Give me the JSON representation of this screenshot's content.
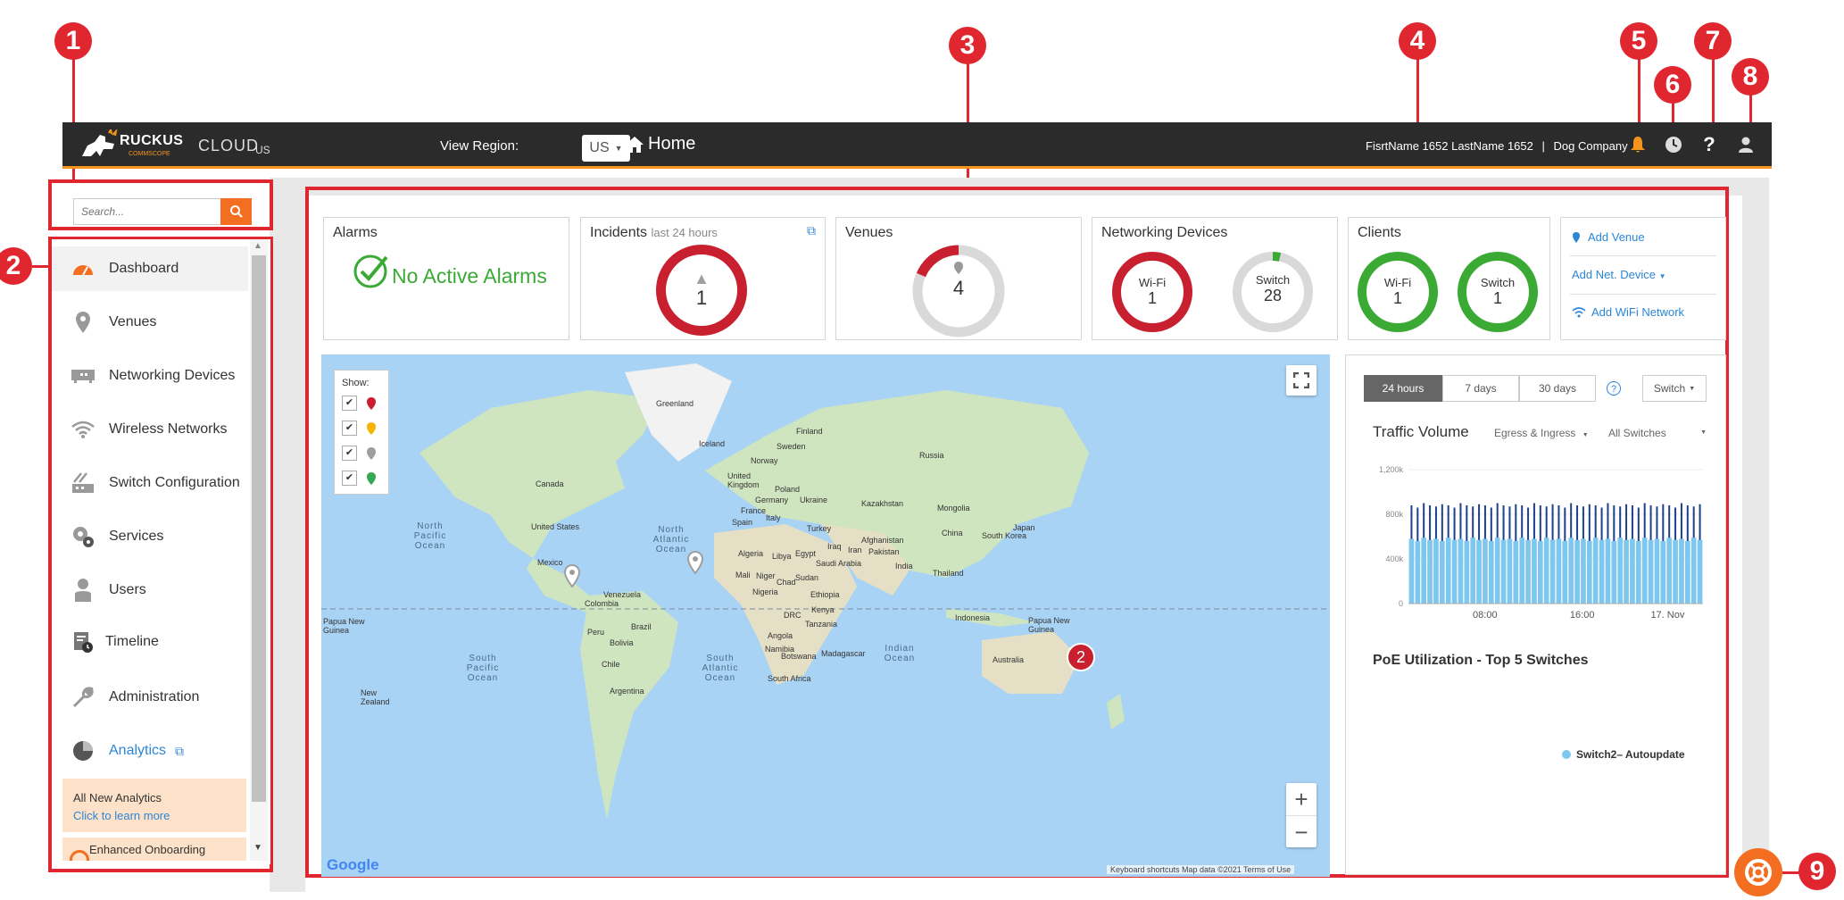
{
  "callouts": [
    "1",
    "2",
    "3",
    "4",
    "5",
    "6",
    "7",
    "8",
    "9"
  ],
  "header": {
    "brand": "RUCKUS",
    "brand_sub": "COMMSCOPE",
    "product": "CLOUD",
    "product_sub": "US",
    "view_region_label": "View Region:",
    "region_value": "US",
    "page_title": "Home",
    "user_name": "FisrtName 1652 LastName 1652",
    "separator": "|",
    "company": "Dog Company",
    "icons": [
      "bell-icon",
      "clock-icon",
      "help-icon",
      "user-icon"
    ]
  },
  "search": {
    "placeholder": "Search..."
  },
  "sidebar": {
    "items": [
      {
        "label": "Dashboard",
        "icon": "dashboard-icon"
      },
      {
        "label": "Venues",
        "icon": "location-pin-icon"
      },
      {
        "label": "Networking Devices",
        "icon": "device-icon"
      },
      {
        "label": "Wireless Networks",
        "icon": "wifi-icon"
      },
      {
        "label": "Switch Configuration",
        "icon": "switch-config-icon"
      },
      {
        "label": "Services",
        "icon": "gear-icon"
      },
      {
        "label": "Users",
        "icon": "user-icon"
      },
      {
        "label": "Timeline",
        "icon": "timeline-icon"
      },
      {
        "label": "Administration",
        "icon": "wrench-icon"
      },
      {
        "label": "Analytics",
        "icon": "pie-icon"
      }
    ],
    "promo1_title": "All New Analytics",
    "promo1_link": "Click to learn more",
    "promo2_title": "Enhanced Onboarding"
  },
  "cards": {
    "alarms": {
      "title": "Alarms",
      "status": "No Active Alarms"
    },
    "incidents": {
      "title": "Incidents",
      "sub": "last 24 hours",
      "value": "1"
    },
    "venues": {
      "title": "Venues",
      "value": "4"
    },
    "networking": {
      "title": "Networking Devices",
      "wifi_label": "Wi-Fi",
      "wifi_value": "1",
      "switch_label": "Switch",
      "switch_value": "28"
    },
    "clients": {
      "title": "Clients",
      "wifi_label": "Wi-Fi",
      "wifi_value": "1",
      "switch_label": "Switch",
      "switch_value": "1"
    },
    "actions": {
      "add_venue": "Add Venue",
      "add_device": "Add Net. Device",
      "add_wifi": "Add WiFi Network"
    }
  },
  "map": {
    "show_label": "Show:",
    "marker_colors": [
      "#c8202f",
      "#f4b400",
      "#9e9e9e",
      "#34a853"
    ],
    "cluster_count": "2",
    "labels": {
      "greenland": "Greenland",
      "iceland": "Iceland",
      "finland": "Finland",
      "sweden": "Sweden",
      "norway": "Norway",
      "russia": "Russia",
      "uk": "United Kingdom",
      "poland": "Poland",
      "germany": "Germany",
      "ukraine": "Ukraine",
      "france": "France",
      "italy": "Italy",
      "spain": "Spain",
      "turkey": "Turkey",
      "kazakhstan": "Kazakhstan",
      "mongolia": "Mongolia",
      "china": "China",
      "south_korea": "South Korea",
      "japan": "Japan",
      "iraq": "Iraq",
      "iran": "Iran",
      "afghanistan": "Afghanistan",
      "pakistan": "Pakistan",
      "india": "India",
      "thailand": "Thailand",
      "canada": "Canada",
      "us": "United States",
      "mexico": "Mexico",
      "venezuela": "Venezuela",
      "colombia": "Colombia",
      "brazil": "Brazil",
      "peru": "Peru",
      "bolivia": "Bolivia",
      "chile": "Chile",
      "argentina": "Argentina",
      "algeria": "Algeria",
      "libya": "Libya",
      "egypt": "Egypt",
      "saudi": "Saudi Arabia",
      "mali": "Mali",
      "niger": "Niger",
      "chad": "Chad",
      "sudan": "Sudan",
      "nigeria": "Nigeria",
      "ethiopia": "Ethiopia",
      "kenya": "Kenya",
      "drc": "DRC",
      "tanzania": "Tanzania",
      "angola": "Angola",
      "namibia": "Namibia",
      "botswana": "Botswana",
      "madagascar": "Madagascar",
      "south_africa": "South Africa",
      "indonesia": "Indonesia",
      "png": "Papua New Guinea",
      "png2": "Papua New Guinea",
      "australia": "Australia",
      "new_zealand": "New Zealand",
      "n_pacific": "North Pacific Ocean",
      "n_atlantic": "North Atlantic Ocean",
      "s_pacific": "South Pacific Ocean",
      "s_atlantic": "South Atlantic Ocean",
      "indian": "Indian Ocean"
    },
    "google": "Google",
    "footer": "Keyboard shortcuts   Map data ©2021   Terms of Use"
  },
  "traffic": {
    "tabs": [
      "24 hours",
      "7 days",
      "30 days"
    ],
    "device_select": "Switch",
    "title": "Traffic Volume",
    "direction_select": "Egress & Ingress",
    "scope_select": "All Switches",
    "y_ticks": [
      "1,200k",
      "800k",
      "400k",
      "0"
    ],
    "x_ticks": [
      "08:00",
      "16:00",
      "17. Nov"
    ],
    "poe_title": "PoE Utilization - Top 5 Switches",
    "legend": "Switch2– Autoupdate"
  },
  "chart_data": {
    "type": "bar",
    "title": "Traffic Volume",
    "ylim": [
      0,
      1200000
    ],
    "series": [
      {
        "values": [
          880000,
          860000,
          900000,
          880000,
          870000,
          890000,
          880000,
          860000,
          900000,
          880000,
          870000,
          890000,
          880000,
          860000,
          900000,
          880000,
          870000,
          890000,
          880000,
          860000,
          900000,
          880000,
          870000,
          890000,
          880000,
          860000,
          900000,
          880000,
          870000,
          890000,
          880000,
          860000,
          900000,
          880000,
          870000,
          890000,
          880000,
          860000,
          900000,
          880000,
          870000,
          890000,
          880000,
          860000,
          900000,
          880000,
          870000,
          890000
        ]
      },
      {
        "values": [
          580000,
          560000,
          590000,
          570000,
          580000,
          560000,
          590000,
          570000,
          580000,
          560000,
          590000,
          570000,
          580000,
          560000,
          590000,
          570000,
          580000,
          560000,
          590000,
          570000,
          580000,
          560000,
          590000,
          570000,
          580000,
          560000,
          590000,
          570000,
          580000,
          560000,
          590000,
          570000,
          580000,
          560000,
          590000,
          570000,
          580000,
          560000,
          590000,
          570000,
          580000,
          560000,
          590000,
          570000,
          580000,
          560000,
          590000,
          570000
        ]
      }
    ],
    "colors": [
      "#1f3f8f",
      "#7ec7ee"
    ]
  }
}
